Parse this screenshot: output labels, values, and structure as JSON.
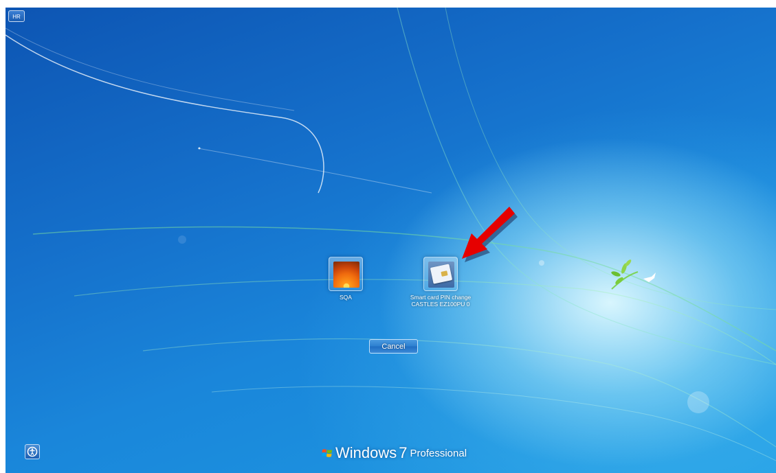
{
  "language_badge": "HR",
  "users": [
    {
      "label_lines": [
        "SQA"
      ],
      "picture": "orange-flower"
    },
    {
      "label_lines": [
        "Smart card PIN change",
        "CASTLES EZ100PU 0"
      ],
      "picture": "smart-card"
    }
  ],
  "cancel_label": "Cancel",
  "branding": {
    "brand": "Windows",
    "version": "7",
    "edition": "Professional"
  },
  "icons": {
    "ease_of_access": "ease-of-access-icon",
    "annotation": "red-arrow-annotation"
  },
  "colors": {
    "background": "#1a7fd6",
    "annotation_arrow": "#e60000"
  }
}
